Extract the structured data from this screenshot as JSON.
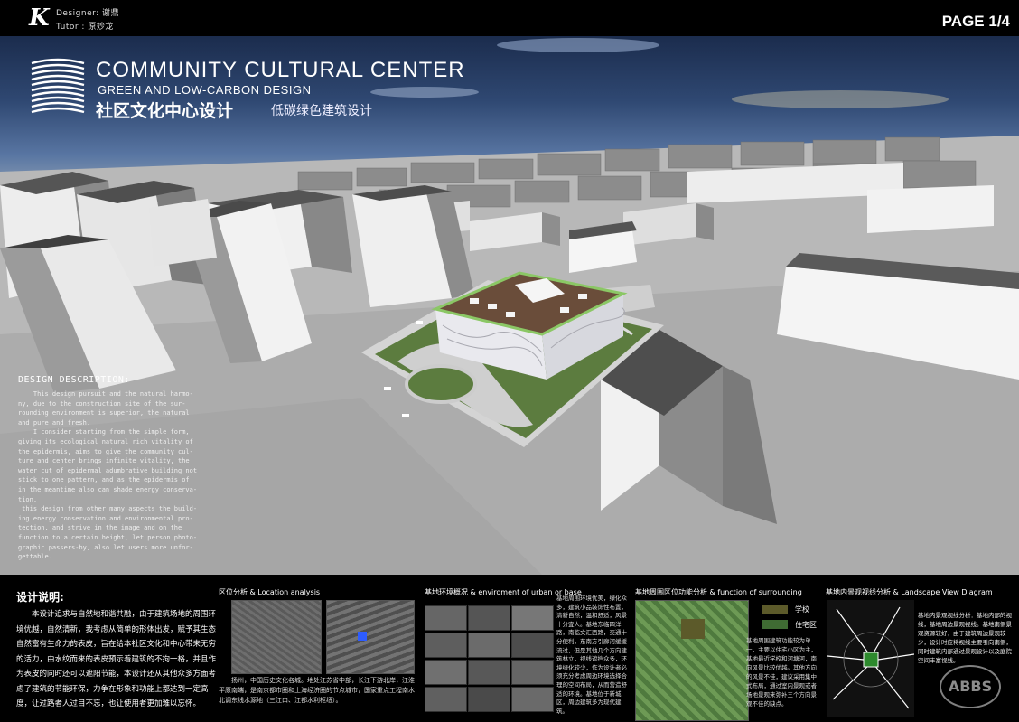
{
  "header": {
    "logo": "K",
    "designer": "Designer: 谢鼎",
    "tutor": "Tutor : 原妙龙",
    "page": "PAGE 1/4"
  },
  "title": {
    "main": "COMMUNITY CULTURAL CENTER",
    "sub": "GREEN AND LOW-CARBON DESIGN",
    "cn": "社区文化中心设计",
    "cn_sub": "低碳绿色建筑设计"
  },
  "design_description": {
    "heading": "DESIGN DESCRIPTION:",
    "body": "    This design pursuit and the natural harmo-\nny, due to the construction site of the sur-\nrounding environment is superior, the natural\nand pure and fresh.\n    I consider starting from the simple form,\ngiving its ecological natural rich vitality of\nthe epidermis, aims to give the community cul-\nture and center brings infinite vitality, the\nwater cut of epidermal adumbrative building not\nstick to one pattern, and as the epidermis of\nin the meantime also can shade energy conserva-\ntion.\n this design from other many aspects the build-\ning energy conservation and environmental pro-\ntection, and strive in the image and on the\nfunction to a certain height, let person photo-\ngraphic passers-by, also let users more unfor-\ngettable."
  },
  "cn_description": {
    "heading": "设计说明:",
    "body": "本设计追求与自然地和谐共融，由于建筑场地的周围环境优越，自然清新，我考虑从简单的形体出发，赋予其生态自然富有生命力的表皮，旨在给本社区文化和中心带来无穷的活力，由水纹而来的表皮预示着建筑的不拘一格，并且作为表皮的同时还可以遮阳节能，本设计还从其他众多方面考虑了建筑的节能环保，力争在形象和功能上都达到一定高度，让过路者人过目不忘，也让使用者更加难以忘怀。"
  },
  "sections": {
    "location": {
      "title": "区位分析 & Location analysis",
      "caption": "扬州，中国历史文化名城。地处江苏省中部，长江下游北岸，江淮平原南端，是南京都市圈和上海经济圈的节点城市，国家重点工程南水北调东线水源地（三江口、江都水利枢纽）。"
    },
    "environment": {
      "title": "基地环境概况 & enviroment of urban or base",
      "caption": "基地周围环境优美，绿化众多，建筑小品装饰性布置，清新自然，温和舒适，风景十分宜人。基地东临四洋路，南临文汇西路，交通十分便利，东南方引廊河缓缓流过，但是其他几个方向建筑林立，视线遮挡众多，环境绿化较少，作为设计者必须充分考虑周边环境选择合理的空间布局，从而营造舒适的环境。基地位于新城区，周边建筑多为现代建筑。"
    },
    "function": {
      "title": "基地周围区位功能分析 & function of surrounding",
      "legend": [
        {
          "label": "学校",
          "color": "#5c5a2a"
        },
        {
          "label": "住宅区",
          "color": "#3f6b33"
        }
      ],
      "caption": "基地周围建筑功能较为单一，主要以住宅小区为主，基地最近学校和河塘河，南向风景比较优越。其他方向的风景不佳，建议采用集中式布局，通过室内景观或者场地景观来弥补三个方向景观不佳的缺点。"
    },
    "landscape": {
      "title": "基地内景观视线分析 & Landscape View Diagram",
      "caption": "基地内景观视线分析：基地内部的视线，基地周边景观视线。基地南侧景观资源较好，由于建筑周边景观较少，设计时应将视线主要引向南侧，同时建筑内部通过景观设计以及庭院空间丰富视线。"
    },
    "watermark": "ABBS"
  }
}
